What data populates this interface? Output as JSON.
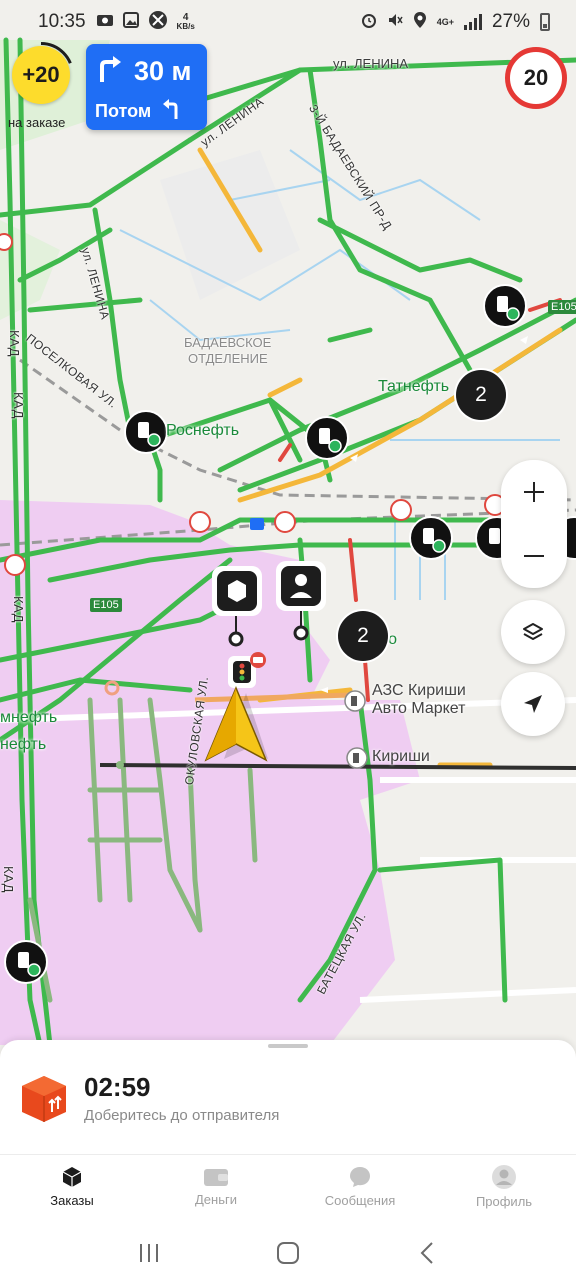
{
  "status_bar": {
    "time": "10:35",
    "net_speed_value": "4",
    "net_speed_unit": "KB/s",
    "network_type": "4G+",
    "battery_percent": "27%"
  },
  "bonus": {
    "value": "+20",
    "label": "на заказе"
  },
  "maneuver": {
    "distance": "30 м",
    "then_label": "Потом"
  },
  "speed_limit": {
    "value": "20"
  },
  "map_labels": {
    "lenina_top": "ул. ЛЕНИНА",
    "lenina_diag": "ул. ЛЕНИНА",
    "lenina_vert": "ул. ЛЕНИНА",
    "badaevsky": "3-Й БАДАЕВСКИЙ ПР-Д",
    "district_line1": "БАДАЕВСКОЕ",
    "district_line2": "ОТДЕЛЕНИЕ",
    "poselkovaya": "ПОСЕЛКОВАЯ УЛ.",
    "kad1": "КАД",
    "kad2": "КАД",
    "kad3": "КАД",
    "kad4": "КАД",
    "e105_left": "E105",
    "e105_right": "E105",
    "okulovskaya": "ОКУЛОВСКАЯ УЛ.",
    "batetskaya": "БАТЕЦКАЯ УЛ."
  },
  "poi_labels": {
    "tatneft": "Татнефть",
    "rosneft": "Роснефть",
    "eko": "еко",
    "azs_line1": "АЗС Кириши",
    "azs_line2": "Авто Маркет",
    "kirishi": "Кириши",
    "mneft": "мнефть",
    "neft": "нефть"
  },
  "clusters": [
    "2",
    "2"
  ],
  "order": {
    "timer": "02:59",
    "hint": "Доберитесь до отправителя"
  },
  "tabs": [
    {
      "label": "Заказы",
      "icon": "box-icon",
      "active": true
    },
    {
      "label": "Деньги",
      "icon": "wallet-icon",
      "active": false
    },
    {
      "label": "Сообщения",
      "icon": "chat-icon",
      "active": false
    },
    {
      "label": "Профиль",
      "icon": "avatar-icon",
      "active": false
    }
  ],
  "colors": {
    "accent_blue": "#1f6ef5",
    "bonus_yellow": "#fddc2c",
    "traffic_green": "#3fb94d",
    "traffic_orange": "#f4b73a",
    "traffic_red": "#e0483f",
    "zone_pink": "#efcdf2",
    "poi_green": "#1a8a3a"
  }
}
